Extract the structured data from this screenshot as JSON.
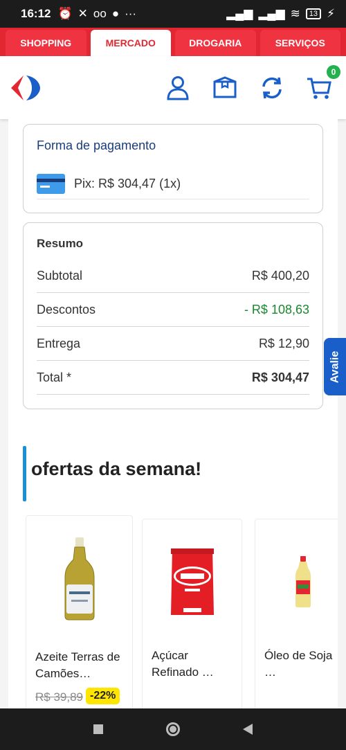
{
  "status_bar": {
    "time": "16:12",
    "battery": "13"
  },
  "tabs": [
    {
      "label": "SHOPPING",
      "active": false
    },
    {
      "label": "MERCADO",
      "active": true
    },
    {
      "label": "DROGARIA",
      "active": false
    },
    {
      "label": "SERVIÇOS",
      "active": false
    }
  ],
  "header": {
    "cart_count": "0"
  },
  "payment": {
    "title": "Forma de pagamento",
    "method_text": "Pix: R$ 304,47 (1x)"
  },
  "summary": {
    "title": "Resumo",
    "rows": [
      {
        "label": "Subtotal",
        "value": "R$ 400,20"
      },
      {
        "label": "Descontos",
        "value": "- R$ 108,63"
      },
      {
        "label": "Entrega",
        "value": "R$ 12,90"
      },
      {
        "label": "Total *",
        "value": "R$ 304,47"
      }
    ]
  },
  "offers": {
    "title": "ofertas da semana!",
    "products": [
      {
        "name": "Azeite Terras de Camões…",
        "old_price": "R$ 39,89",
        "discount": "-22%"
      },
      {
        "name": "Açúcar Refinado …"
      },
      {
        "name": "Óleo de Soja …"
      }
    ]
  },
  "feedback_tab": {
    "label": "Avalie"
  },
  "colors": {
    "brand_red": "#e32732",
    "brand_blue": "#1a5fc9",
    "discount_green": "#17882c",
    "badge_yellow": "#ffe600"
  }
}
